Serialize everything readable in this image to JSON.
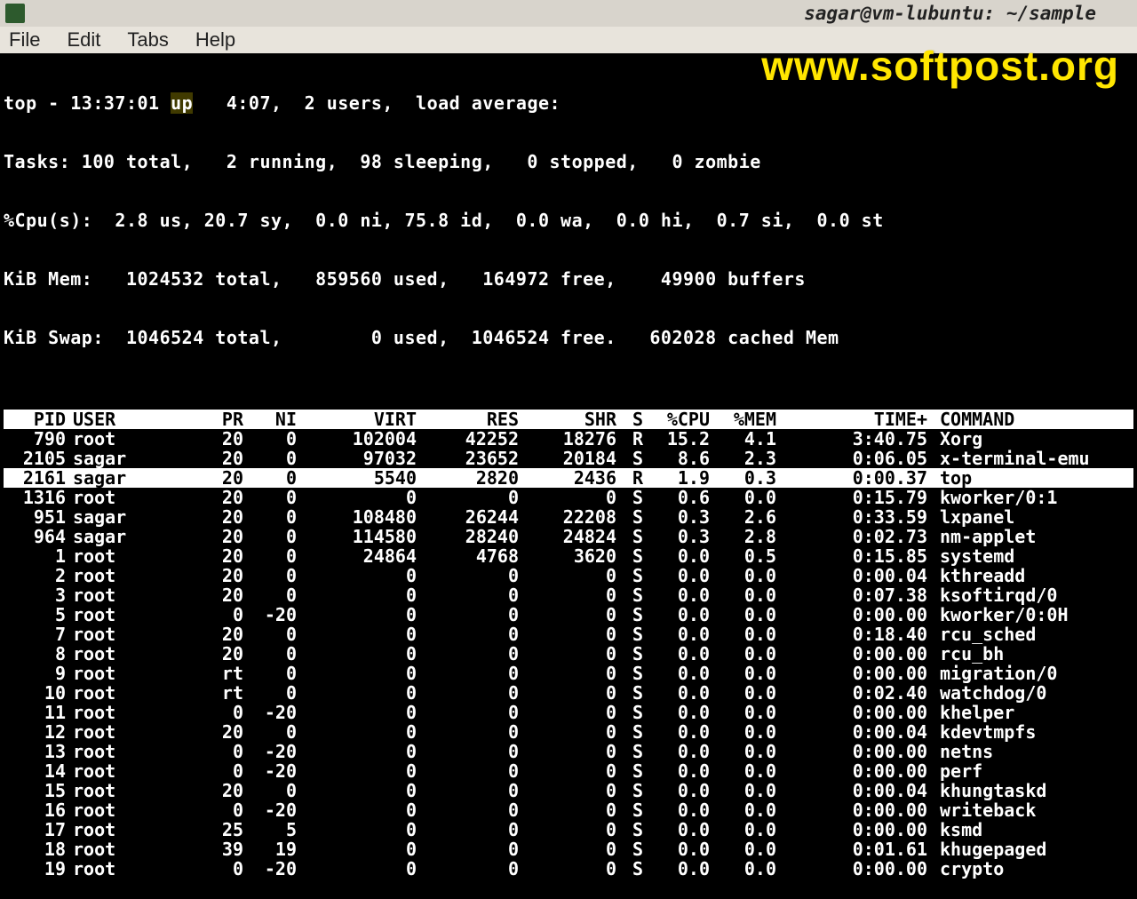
{
  "watermark": "www.softpost.org",
  "window": {
    "title": "sagar@vm-lubuntu: ~/sample"
  },
  "menu": {
    "file": "File",
    "edit": "Edit",
    "tabs": "Tabs",
    "help": "Help"
  },
  "summary": {
    "l1a": "top - 13:37:01 ",
    "l1_up": "up",
    "l1b": "   4:07,  2 users,  load average:",
    "l2": "Tasks: 100 total,   2 running,  98 sleeping,   0 stopped,   0 zombie",
    "l3": "%Cpu(s):  2.8 us, 20.7 sy,  0.0 ni, 75.8 id,  0.0 wa,  0.0 hi,  0.7 si,  0.0 st",
    "l4": "KiB Mem:   1024532 total,   859560 used,   164972 free,    49900 buffers",
    "l5": "KiB Swap:  1046524 total,        0 used,  1046524 free.   602028 cached Mem"
  },
  "columns": {
    "pid": "PID",
    "user": "USER",
    "pr": "PR",
    "ni": "NI",
    "virt": "VIRT",
    "res": "RES",
    "shr": "SHR",
    "s": "S",
    "cpu": "%CPU",
    "mem": "%MEM",
    "time": "TIME+",
    "cmd": "COMMAND"
  },
  "rows": [
    {
      "pid": "790",
      "user": "root",
      "pr": "20",
      "ni": "0",
      "virt": "102004",
      "res": "42252",
      "shr": "18276",
      "s": "R",
      "cpu": "15.2",
      "mem": "4.1",
      "time": "3:40.75",
      "cmd": "Xorg"
    },
    {
      "pid": "2105",
      "user": "sagar",
      "pr": "20",
      "ni": "0",
      "virt": "97032",
      "res": "23652",
      "shr": "20184",
      "s": "S",
      "cpu": "8.6",
      "mem": "2.3",
      "time": "0:06.05",
      "cmd": "x-terminal-emu"
    },
    {
      "pid": "2161",
      "user": "sagar",
      "pr": "20",
      "ni": "0",
      "virt": "5540",
      "res": "2820",
      "shr": "2436",
      "s": "R",
      "cpu": "1.9",
      "mem": "0.3",
      "time": "0:00.37",
      "cmd": "top",
      "hl": true
    },
    {
      "pid": "1316",
      "user": "root",
      "pr": "20",
      "ni": "0",
      "virt": "0",
      "res": "0",
      "shr": "0",
      "s": "S",
      "cpu": "0.6",
      "mem": "0.0",
      "time": "0:15.79",
      "cmd": "kworker/0:1"
    },
    {
      "pid": "951",
      "user": "sagar",
      "pr": "20",
      "ni": "0",
      "virt": "108480",
      "res": "26244",
      "shr": "22208",
      "s": "S",
      "cpu": "0.3",
      "mem": "2.6",
      "time": "0:33.59",
      "cmd": "lxpanel"
    },
    {
      "pid": "964",
      "user": "sagar",
      "pr": "20",
      "ni": "0",
      "virt": "114580",
      "res": "28240",
      "shr": "24824",
      "s": "S",
      "cpu": "0.3",
      "mem": "2.8",
      "time": "0:02.73",
      "cmd": "nm-applet"
    },
    {
      "pid": "1",
      "user": "root",
      "pr": "20",
      "ni": "0",
      "virt": "24864",
      "res": "4768",
      "shr": "3620",
      "s": "S",
      "cpu": "0.0",
      "mem": "0.5",
      "time": "0:15.85",
      "cmd": "systemd"
    },
    {
      "pid": "2",
      "user": "root",
      "pr": "20",
      "ni": "0",
      "virt": "0",
      "res": "0",
      "shr": "0",
      "s": "S",
      "cpu": "0.0",
      "mem": "0.0",
      "time": "0:00.04",
      "cmd": "kthreadd"
    },
    {
      "pid": "3",
      "user": "root",
      "pr": "20",
      "ni": "0",
      "virt": "0",
      "res": "0",
      "shr": "0",
      "s": "S",
      "cpu": "0.0",
      "mem": "0.0",
      "time": "0:07.38",
      "cmd": "ksoftirqd/0"
    },
    {
      "pid": "5",
      "user": "root",
      "pr": "0",
      "ni": "-20",
      "virt": "0",
      "res": "0",
      "shr": "0",
      "s": "S",
      "cpu": "0.0",
      "mem": "0.0",
      "time": "0:00.00",
      "cmd": "kworker/0:0H"
    },
    {
      "pid": "7",
      "user": "root",
      "pr": "20",
      "ni": "0",
      "virt": "0",
      "res": "0",
      "shr": "0",
      "s": "S",
      "cpu": "0.0",
      "mem": "0.0",
      "time": "0:18.40",
      "cmd": "rcu_sched"
    },
    {
      "pid": "8",
      "user": "root",
      "pr": "20",
      "ni": "0",
      "virt": "0",
      "res": "0",
      "shr": "0",
      "s": "S",
      "cpu": "0.0",
      "mem": "0.0",
      "time": "0:00.00",
      "cmd": "rcu_bh"
    },
    {
      "pid": "9",
      "user": "root",
      "pr": "rt",
      "ni": "0",
      "virt": "0",
      "res": "0",
      "shr": "0",
      "s": "S",
      "cpu": "0.0",
      "mem": "0.0",
      "time": "0:00.00",
      "cmd": "migration/0"
    },
    {
      "pid": "10",
      "user": "root",
      "pr": "rt",
      "ni": "0",
      "virt": "0",
      "res": "0",
      "shr": "0",
      "s": "S",
      "cpu": "0.0",
      "mem": "0.0",
      "time": "0:02.40",
      "cmd": "watchdog/0"
    },
    {
      "pid": "11",
      "user": "root",
      "pr": "0",
      "ni": "-20",
      "virt": "0",
      "res": "0",
      "shr": "0",
      "s": "S",
      "cpu": "0.0",
      "mem": "0.0",
      "time": "0:00.00",
      "cmd": "khelper"
    },
    {
      "pid": "12",
      "user": "root",
      "pr": "20",
      "ni": "0",
      "virt": "0",
      "res": "0",
      "shr": "0",
      "s": "S",
      "cpu": "0.0",
      "mem": "0.0",
      "time": "0:00.04",
      "cmd": "kdevtmpfs"
    },
    {
      "pid": "13",
      "user": "root",
      "pr": "0",
      "ni": "-20",
      "virt": "0",
      "res": "0",
      "shr": "0",
      "s": "S",
      "cpu": "0.0",
      "mem": "0.0",
      "time": "0:00.00",
      "cmd": "netns"
    },
    {
      "pid": "14",
      "user": "root",
      "pr": "0",
      "ni": "-20",
      "virt": "0",
      "res": "0",
      "shr": "0",
      "s": "S",
      "cpu": "0.0",
      "mem": "0.0",
      "time": "0:00.00",
      "cmd": "perf"
    },
    {
      "pid": "15",
      "user": "root",
      "pr": "20",
      "ni": "0",
      "virt": "0",
      "res": "0",
      "shr": "0",
      "s": "S",
      "cpu": "0.0",
      "mem": "0.0",
      "time": "0:00.04",
      "cmd": "khungtaskd"
    },
    {
      "pid": "16",
      "user": "root",
      "pr": "0",
      "ni": "-20",
      "virt": "0",
      "res": "0",
      "shr": "0",
      "s": "S",
      "cpu": "0.0",
      "mem": "0.0",
      "time": "0:00.00",
      "cmd": "writeback"
    },
    {
      "pid": "17",
      "user": "root",
      "pr": "25",
      "ni": "5",
      "virt": "0",
      "res": "0",
      "shr": "0",
      "s": "S",
      "cpu": "0.0",
      "mem": "0.0",
      "time": "0:00.00",
      "cmd": "ksmd"
    },
    {
      "pid": "18",
      "user": "root",
      "pr": "39",
      "ni": "19",
      "virt": "0",
      "res": "0",
      "shr": "0",
      "s": "S",
      "cpu": "0.0",
      "mem": "0.0",
      "time": "0:01.61",
      "cmd": "khugepaged"
    },
    {
      "pid": "19",
      "user": "root",
      "pr": "0",
      "ni": "-20",
      "virt": "0",
      "res": "0",
      "shr": "0",
      "s": "S",
      "cpu": "0.0",
      "mem": "0.0",
      "time": "0:00.00",
      "cmd": "crypto"
    }
  ]
}
